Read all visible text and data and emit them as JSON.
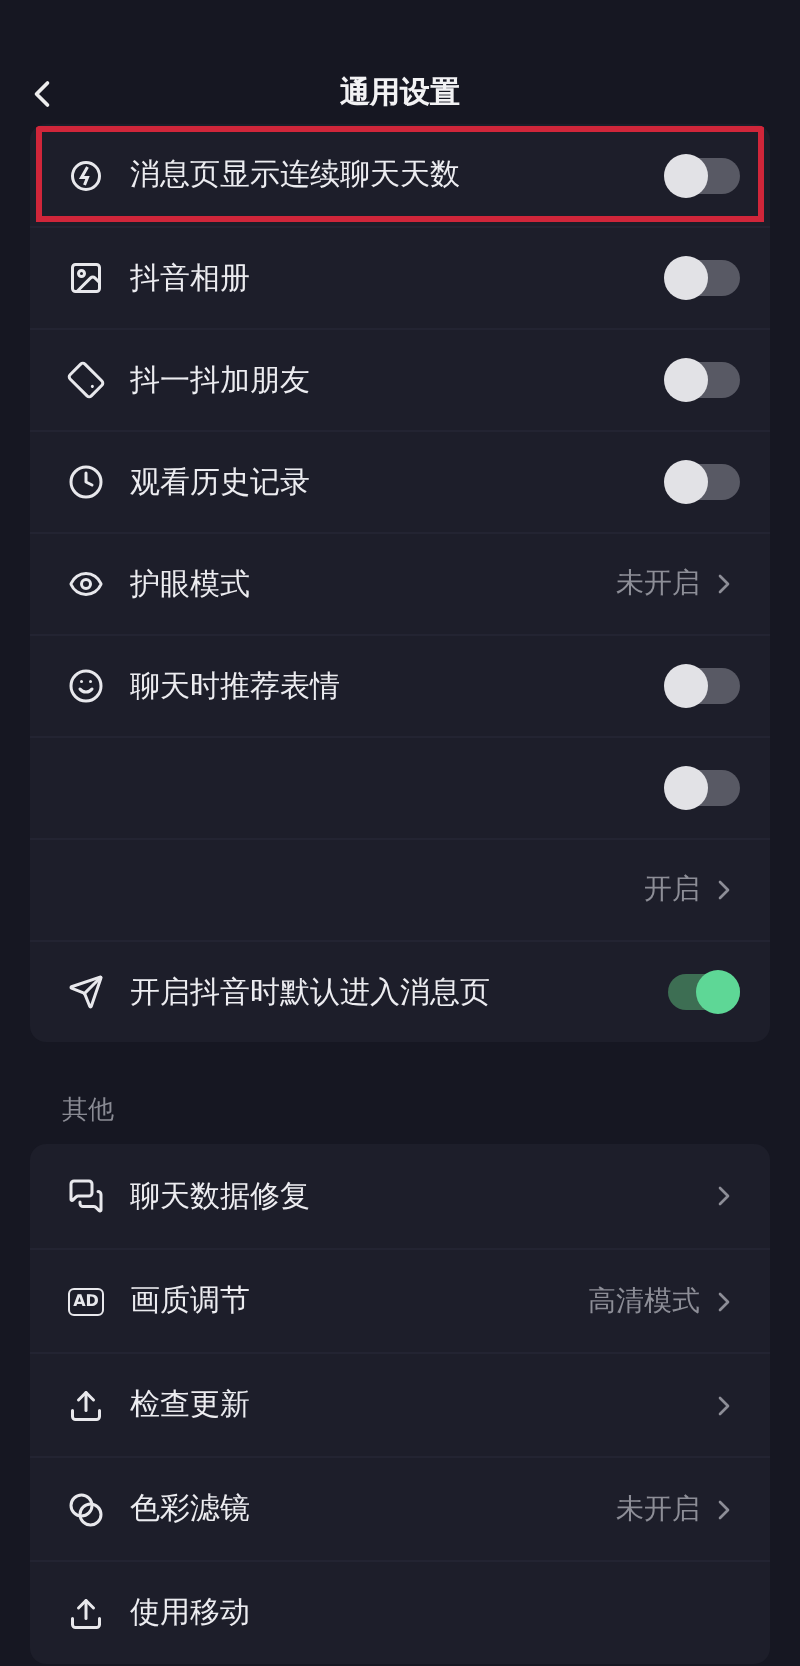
{
  "header": {
    "title": "通用设置"
  },
  "general": [
    {
      "kind": "toggle",
      "label": "消息页显示连续聊天天数",
      "on": false,
      "highlighted": true
    },
    {
      "kind": "toggle",
      "label": "抖音相册",
      "on": false,
      "highlighted": false
    },
    {
      "kind": "toggle",
      "label": "抖一抖加朋友",
      "on": false,
      "highlighted": false
    },
    {
      "kind": "toggle",
      "label": "观看历史记录",
      "on": false,
      "highlighted": false
    },
    {
      "kind": "link",
      "label": "护眼模式",
      "value": "未开启",
      "highlighted": false
    },
    {
      "kind": "toggle",
      "label": "聊天时推荐表情",
      "on": false,
      "highlighted": false
    },
    {
      "kind": "toggle",
      "on": false,
      "highlighted": false
    },
    {
      "kind": "link",
      "value": "开启",
      "highlighted": false
    },
    {
      "kind": "toggle",
      "label": "开启抖音时默认进入消息页",
      "on": true,
      "highlighted": false
    }
  ],
  "other_section": {
    "title": "其他"
  },
  "other": [
    {
      "kind": "link",
      "label": "聊天数据修复"
    },
    {
      "kind": "link",
      "label": "画质调节",
      "value": "高清模式",
      "badge": "AD"
    },
    {
      "kind": "link",
      "label": "检查更新"
    },
    {
      "kind": "link",
      "label": "色彩滤镜",
      "value": "未开启"
    },
    {
      "kind": "plain",
      "label": "使用移动"
    }
  ]
}
